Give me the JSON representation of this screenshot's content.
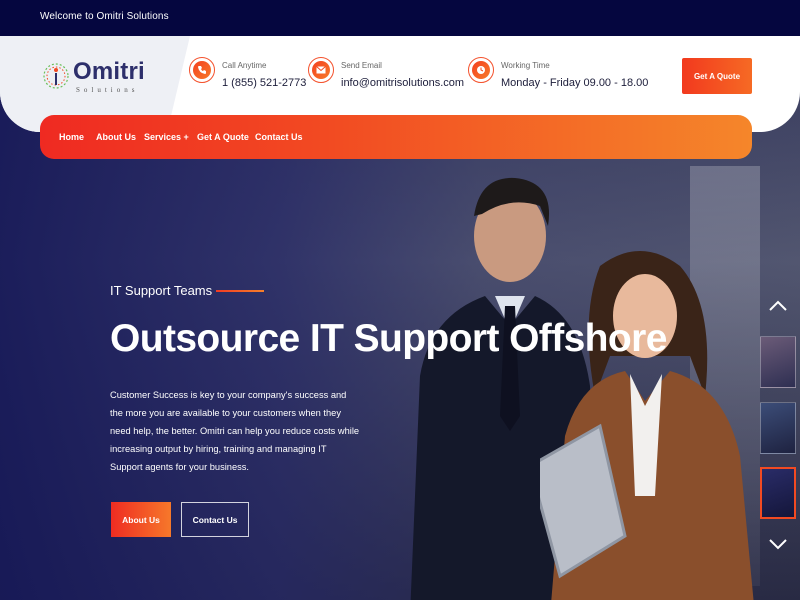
{
  "topbar": {
    "welcome": "Welcome to Omitri Solutions"
  },
  "brand": {
    "name": "Omitri",
    "sub": "Solutions"
  },
  "contact_info": [
    {
      "icon": "phone-icon",
      "label": "Call Anytime",
      "value": "1 (855) 521-2773"
    },
    {
      "icon": "email-icon",
      "label": "Send Email",
      "value": "info@omitrisolutions.com"
    },
    {
      "icon": "clock-icon",
      "label": "Working Time",
      "value": "Monday - Friday 09.00 - 18.00"
    }
  ],
  "header": {
    "quote_button": "Get A Quote"
  },
  "nav": {
    "items": [
      "Home",
      "About Us",
      "Services +",
      "Get A Quote",
      "Contact Us"
    ]
  },
  "hero": {
    "eyebrow": "IT Support Teams",
    "title": "Outsource IT Support Offshore",
    "description": "Customer Success is key to your company's success and the more you are available to your customers when they need help, the better. Omitri can help you reduce costs while increasing output by hiring, training and managing IT Support agents for your business.",
    "buttons": {
      "about": "About Us",
      "contact": "Contact Us"
    }
  },
  "colors": {
    "accent": "#f24a22",
    "accent_light": "#f6862a",
    "dark": "#05063f"
  }
}
